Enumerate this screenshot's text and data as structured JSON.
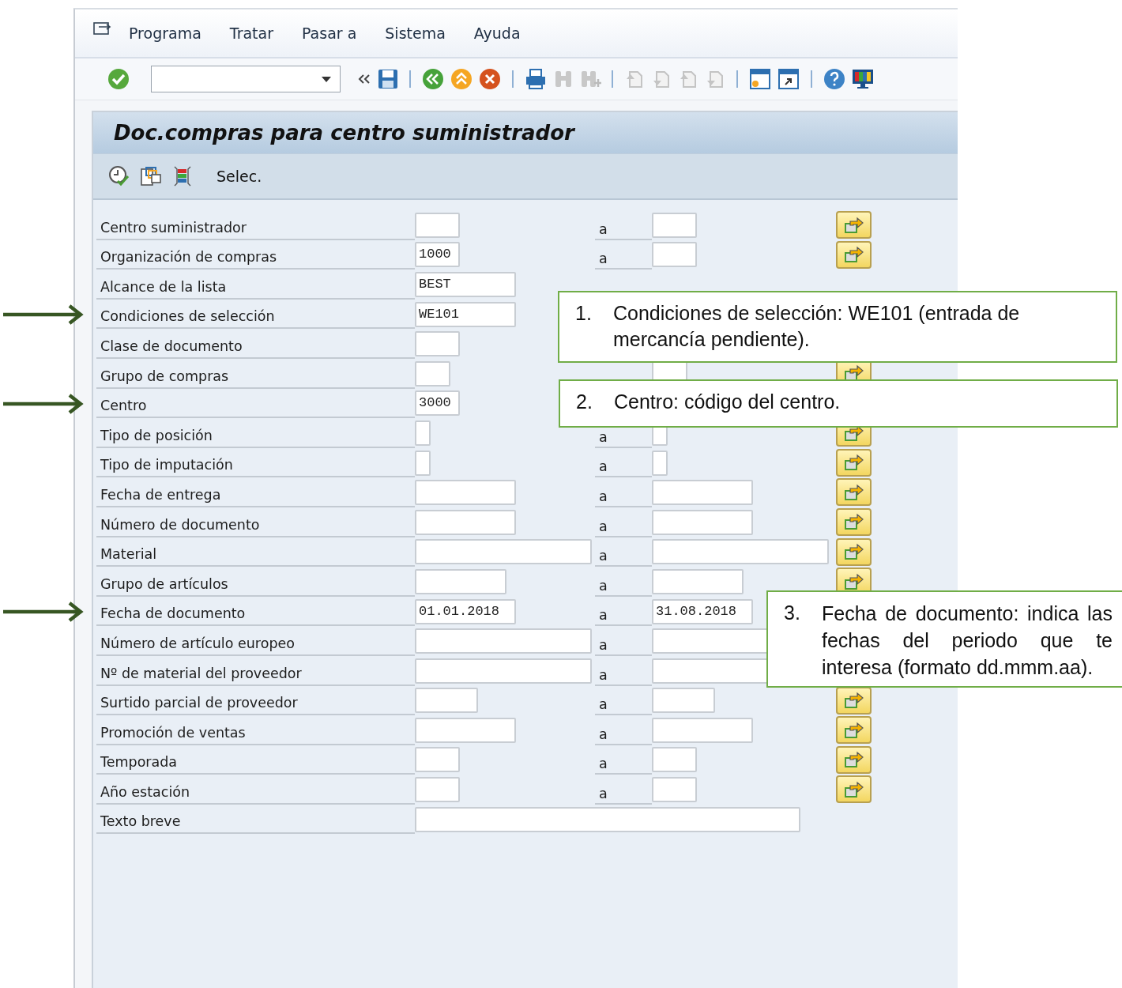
{
  "menu_bar": {
    "items": [
      "Programa",
      "Tratar",
      "Pasar a",
      "Sistema",
      "Ayuda"
    ]
  },
  "screen": {
    "title": "Doc.compras para centro suministrador",
    "toolbar_label": "Selec."
  },
  "form": {
    "rows": [
      {
        "label": "Centro suministrador",
        "kind": "short",
        "range": {
          "label": "a",
          "kind": "short"
        },
        "multiple": true
      },
      {
        "label": "Organización de compras",
        "kind": "short",
        "value": "1000",
        "range": {
          "label": "a",
          "kind": "short"
        },
        "multiple": true
      },
      {
        "label": "Alcance de la lista",
        "kind": "medium",
        "value": "BEST"
      },
      {
        "label": "Condiciones de selección",
        "kind": "medium",
        "value": "WE101",
        "marked": true
      },
      {
        "label": "Clase de documento",
        "kind": "short"
      },
      {
        "label": "Grupo de compras",
        "kind": "narrow",
        "range": {
          "kind": "narrow"
        },
        "multiple": true
      },
      {
        "label": "Centro",
        "kind": "short",
        "value": "3000",
        "marked": true
      },
      {
        "label": "Tipo de posición",
        "kind": "tiny",
        "range": {
          "label": "a",
          "kind": "tiny"
        },
        "multiple": true
      },
      {
        "label": "Tipo de imputación",
        "kind": "tiny",
        "range": {
          "label": "a",
          "kind": "tiny"
        },
        "multiple": true
      },
      {
        "label": "Fecha de entrega",
        "kind": "medium",
        "range": {
          "label": "a",
          "kind": "medium"
        },
        "multiple": true
      },
      {
        "label": "Número de documento",
        "kind": "medium",
        "range": {
          "label": "a",
          "kind": "medium"
        },
        "multiple": true
      },
      {
        "label": "Material",
        "kind": "long",
        "range": {
          "label": "a",
          "kind": "long"
        },
        "multiple": true
      },
      {
        "label": "Grupo de artículos",
        "kind": "mid",
        "range": {
          "label": "a",
          "kind": "mid"
        },
        "multiple": true
      },
      {
        "label": "Fecha de documento",
        "kind": "medium",
        "value": "01.01.2018",
        "range": {
          "label": "a",
          "kind": "medium",
          "value": "31.08.2018"
        },
        "marked": true
      },
      {
        "label": "Número de artículo europeo",
        "kind": "long",
        "range": {
          "label": "a",
          "kind": "long"
        }
      },
      {
        "label": "Nº de material del proveedor",
        "kind": "long",
        "range": {
          "label": "a",
          "kind": "long"
        }
      },
      {
        "label": "Surtido parcial de proveedor",
        "kind": "small",
        "range": {
          "label": "a",
          "kind": "small"
        },
        "multiple": true
      },
      {
        "label": "Promoción de ventas",
        "kind": "medium",
        "range": {
          "label": "a",
          "kind": "medium"
        },
        "multiple": true
      },
      {
        "label": "Temporada",
        "kind": "short",
        "range": {
          "label": "a",
          "kind": "short"
        },
        "multiple": true
      },
      {
        "label": "Año estación",
        "kind": "short",
        "range": {
          "label": "a",
          "kind": "short"
        },
        "multiple": true
      },
      {
        "label": "Texto breve",
        "kind": "wide"
      }
    ]
  },
  "annotations": [
    {
      "number": "1.",
      "text": "Condiciones de selección: WE101 (entrada de mercancía pendiente)."
    },
    {
      "number": "2.",
      "text": "Centro: código del centro."
    },
    {
      "number": "3.",
      "text": "Fecha de documento: indica las fechas del periodo que te interesa (formato dd.mmm.aa)."
    }
  ]
}
